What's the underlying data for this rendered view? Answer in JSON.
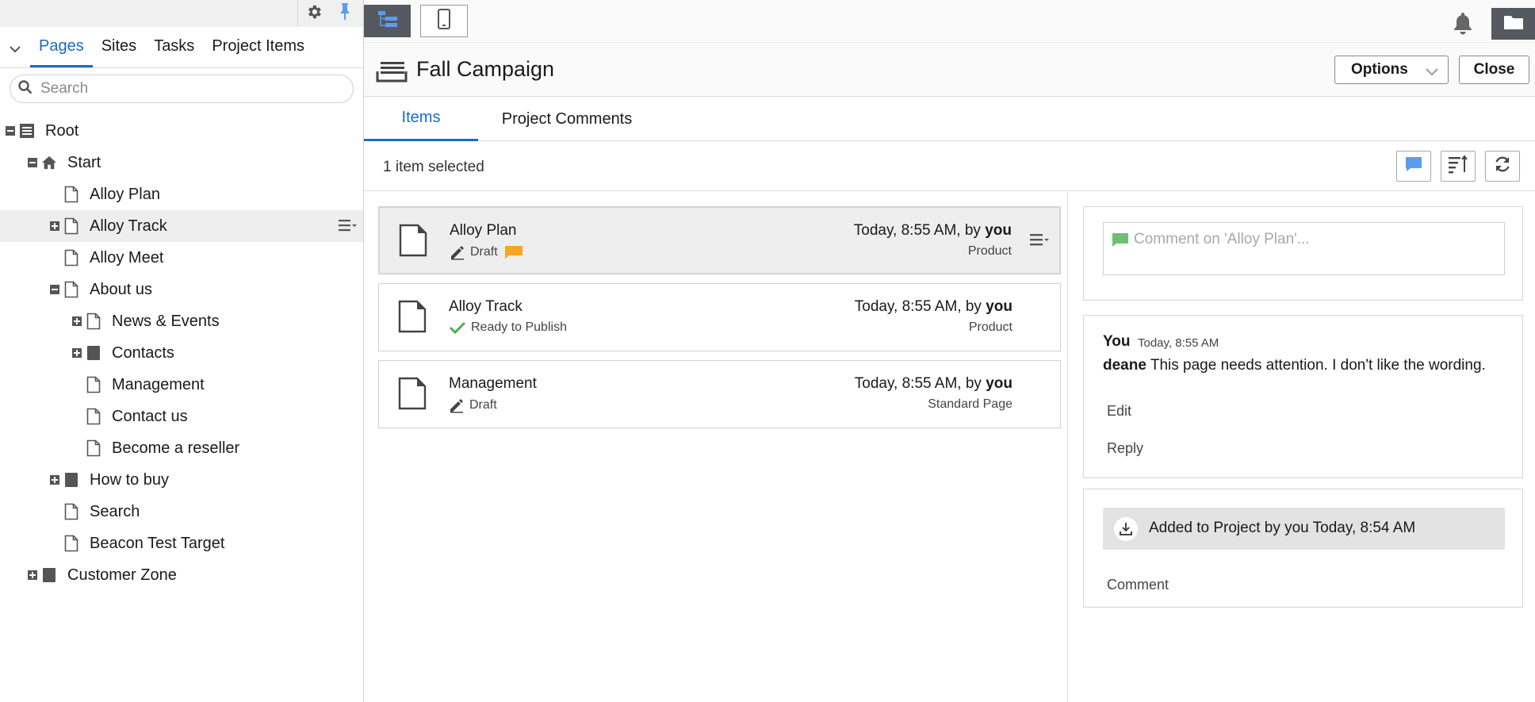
{
  "left_panel": {
    "tabs": [
      {
        "label": "Pages",
        "active": true
      },
      {
        "label": "Sites",
        "active": false
      },
      {
        "label": "Tasks",
        "active": false
      },
      {
        "label": "Project Items",
        "active": false
      }
    ],
    "search_placeholder": "Search",
    "tree": [
      {
        "label": "Root",
        "level": 0,
        "icon": "site-root-icon",
        "expander": "minus"
      },
      {
        "label": "Start",
        "level": 1,
        "icon": "home-icon",
        "expander": "minus"
      },
      {
        "label": "Alloy Plan",
        "level": 2,
        "icon": "page-icon",
        "expander": "none"
      },
      {
        "label": "Alloy Track",
        "level": 2,
        "icon": "page-icon",
        "expander": "plus",
        "hover": true
      },
      {
        "label": "Alloy Meet",
        "level": 2,
        "icon": "page-icon",
        "expander": "none"
      },
      {
        "label": "About us",
        "level": 2,
        "icon": "page-icon",
        "expander": "minus"
      },
      {
        "label": "News & Events",
        "level": 3,
        "icon": "page-icon",
        "expander": "plus"
      },
      {
        "label": "Contacts",
        "level": 3,
        "icon": "container-icon",
        "expander": "plus"
      },
      {
        "label": "Management",
        "level": 3,
        "icon": "page-icon",
        "expander": "none"
      },
      {
        "label": "Contact us",
        "level": 3,
        "icon": "page-icon",
        "expander": "none"
      },
      {
        "label": "Become a reseller",
        "level": 3,
        "icon": "page-icon",
        "expander": "none"
      },
      {
        "label": "How to buy",
        "level": 2,
        "icon": "container-icon",
        "expander": "plus"
      },
      {
        "label": "Search",
        "level": 2,
        "icon": "page-icon",
        "expander": "none"
      },
      {
        "label": "Beacon Test Target",
        "level": 2,
        "icon": "page-icon",
        "expander": "none"
      },
      {
        "label": "Customer Zone",
        "level": 1,
        "icon": "container-icon",
        "expander": "plus"
      }
    ]
  },
  "project": {
    "title": "Fall Campaign",
    "options_label": "Options",
    "close_label": "Close",
    "tabs": [
      {
        "label": "Items",
        "active": true
      },
      {
        "label": "Project Comments",
        "active": false
      }
    ],
    "selection_text": "1 item selected",
    "items": [
      {
        "name": "Alloy Plan",
        "status": "Draft",
        "status_icon": "pencil-icon",
        "has_comment": true,
        "date": "Today, 8:55 AM, by ",
        "by": "you",
        "type": "Product",
        "selected": true
      },
      {
        "name": "Alloy Track",
        "status": "Ready to Publish",
        "status_icon": "check-icon",
        "has_comment": false,
        "date": "Today, 8:55 AM, by ",
        "by": "you",
        "type": "Product",
        "selected": false
      },
      {
        "name": "Management",
        "status": "Draft",
        "status_icon": "pencil-icon",
        "has_comment": false,
        "date": "Today, 8:55 AM, by ",
        "by": "you",
        "type": "Standard Page",
        "selected": false
      }
    ]
  },
  "comments": {
    "placeholder": "Comment on 'Alloy Plan'...",
    "thread": {
      "author": "You",
      "time": "Today, 8:55 AM",
      "mention": "deane",
      "text": " This page needs attention. I don't like the wording.",
      "edit_label": "Edit",
      "reply_label": "Reply"
    },
    "activity": {
      "text": "Added to Project by you Today, 8:54 AM",
      "comment_label": "Comment"
    }
  },
  "colors": {
    "accent": "#1b6ac9",
    "toolbar_dark": "#55595f",
    "comment_green": "#6cc070",
    "comment_orange": "#f5a623",
    "check_green": "#4caf50",
    "pin_blue": "#5b9cf0"
  }
}
